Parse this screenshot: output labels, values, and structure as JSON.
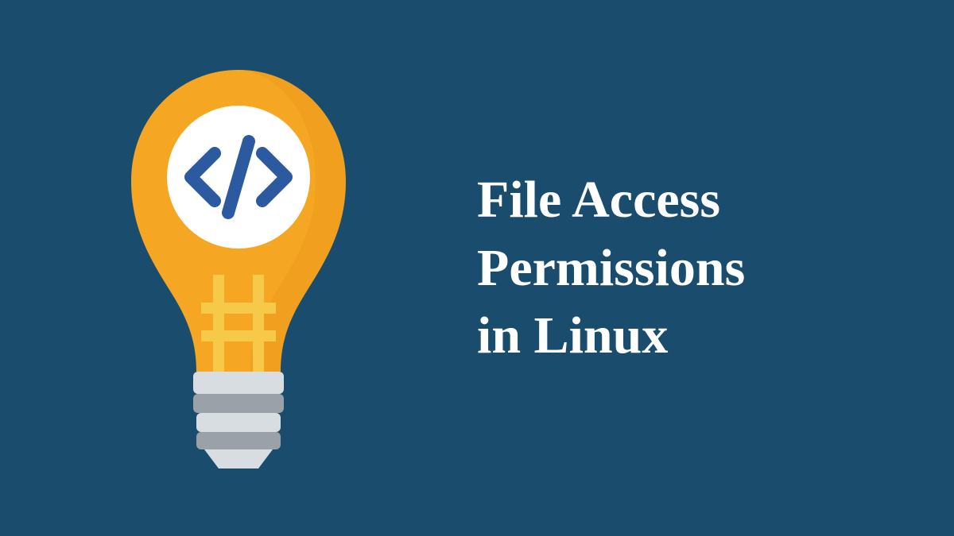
{
  "title_line1": "File Access",
  "title_line2": "Permissions",
  "title_line3": "in Linux",
  "colors": {
    "background": "#1a4d6d",
    "bulb_orange": "#f5a623",
    "bulb_orange_dark": "#e89418",
    "filament_yellow": "#f7c948",
    "white": "#ffffff",
    "code_blue": "#2c5aa0",
    "base_light": "#d8dde2",
    "base_mid": "#b8bec5",
    "base_dark": "#9aa1a9",
    "text": "#ffffff"
  },
  "icon_semantic": "lightbulb-code-icon"
}
